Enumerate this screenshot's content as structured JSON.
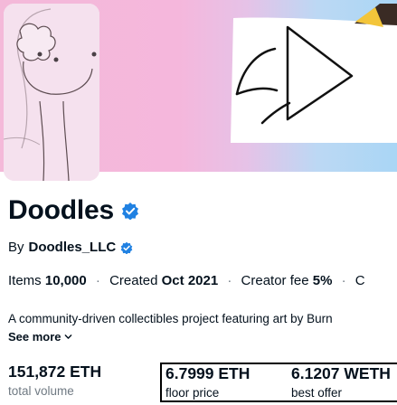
{
  "collection": {
    "name": "Doodles",
    "by_label": "By",
    "creator": "Doodles_LLC"
  },
  "stats": {
    "items_label": "Items",
    "items_value": "10,000",
    "created_label": "Created",
    "created_value": "Oct 2021",
    "fee_label": "Creator fee",
    "fee_value": "5%",
    "extra_label": "C"
  },
  "description": "A community-driven collectibles project featuring art by Burn",
  "see_more_label": "See more",
  "metrics": [
    {
      "value": "151,872 ETH",
      "label": "total volume"
    },
    {
      "value": "6.7999 ETH",
      "label": "floor price"
    },
    {
      "value": "6.1207 WETH",
      "label": "best offer"
    }
  ],
  "colors": {
    "text": "#04111d",
    "muted": "#707a83",
    "verified": "#2081e2",
    "banner_pink": "#f6a9d8",
    "banner_blue": "#a9d6f5"
  }
}
